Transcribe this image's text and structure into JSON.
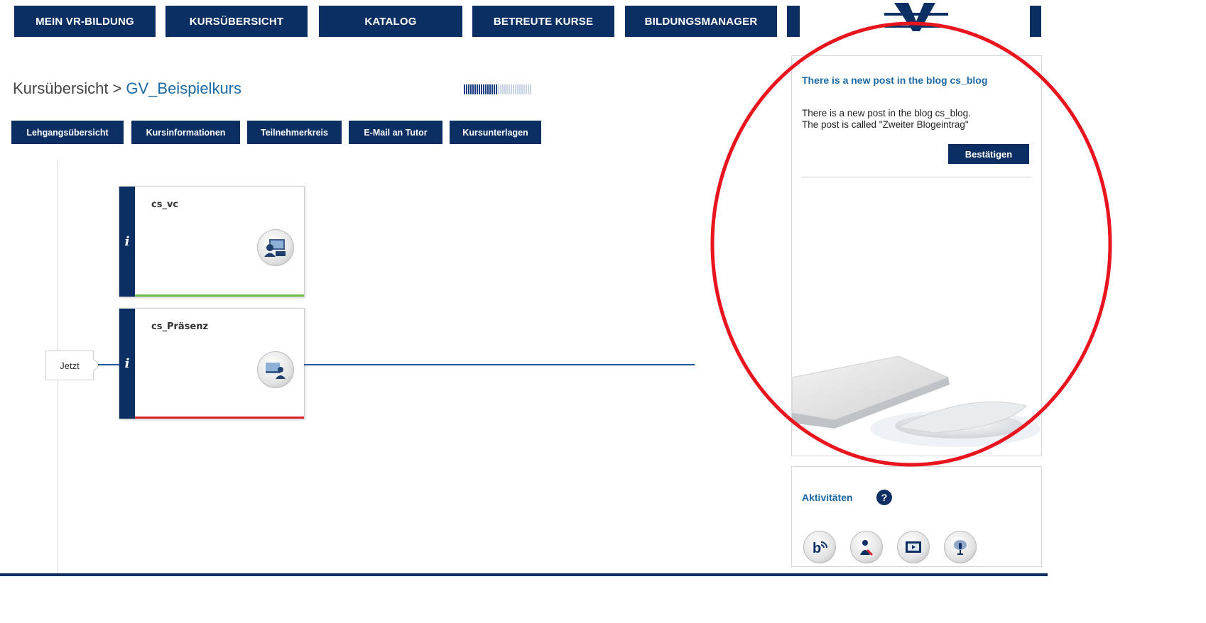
{
  "nav": {
    "items": [
      "MEIN VR-BILDUNG",
      "KURSÜBERSICHT",
      "KATALOG",
      "BETREUTE KURSE",
      "BILDUNGSMANAGER"
    ]
  },
  "logo": {
    "icon": "vr-logo-icon",
    "color": "#0b2f63"
  },
  "breadcrumb": {
    "root": "Kursübersicht",
    "separator": ">",
    "current": "GV_Beispielkurs"
  },
  "progress": {
    "filled_fraction": 0.5,
    "segments_total": 32,
    "segments_filled": 16
  },
  "subnav": {
    "items": [
      "Lehgangsübersicht",
      "Kursinformationen",
      "Teilnehmerkreis",
      "E-Mail an Tutor",
      "Kursunterlagen"
    ]
  },
  "modules": [
    {
      "title": "cs_vc",
      "info": "i",
      "icon": "virtual-classroom-icon",
      "status_color": "#6fbf4a"
    },
    {
      "title": "cs_Präsenz",
      "info": "i",
      "icon": "presence-training-icon",
      "status_color": "#d9232d"
    }
  ],
  "timeline": {
    "now_label": "Jetzt"
  },
  "notification": {
    "title": "There is a new post in the blog cs_blog",
    "line1": "There is a new post in the blog cs_blog.",
    "line2": "The post is called \"Zweiter Blogeintrag\"",
    "confirm_label": "Bestätigen"
  },
  "activities": {
    "title": "Aktivitäten",
    "help": "?",
    "icons": [
      "blog-icon",
      "tutor-icon",
      "video-icon",
      "podcast-icon"
    ]
  },
  "colors": {
    "brand": "#0b2f63",
    "link": "#1b6aa5",
    "annotation": "#e8141e"
  }
}
